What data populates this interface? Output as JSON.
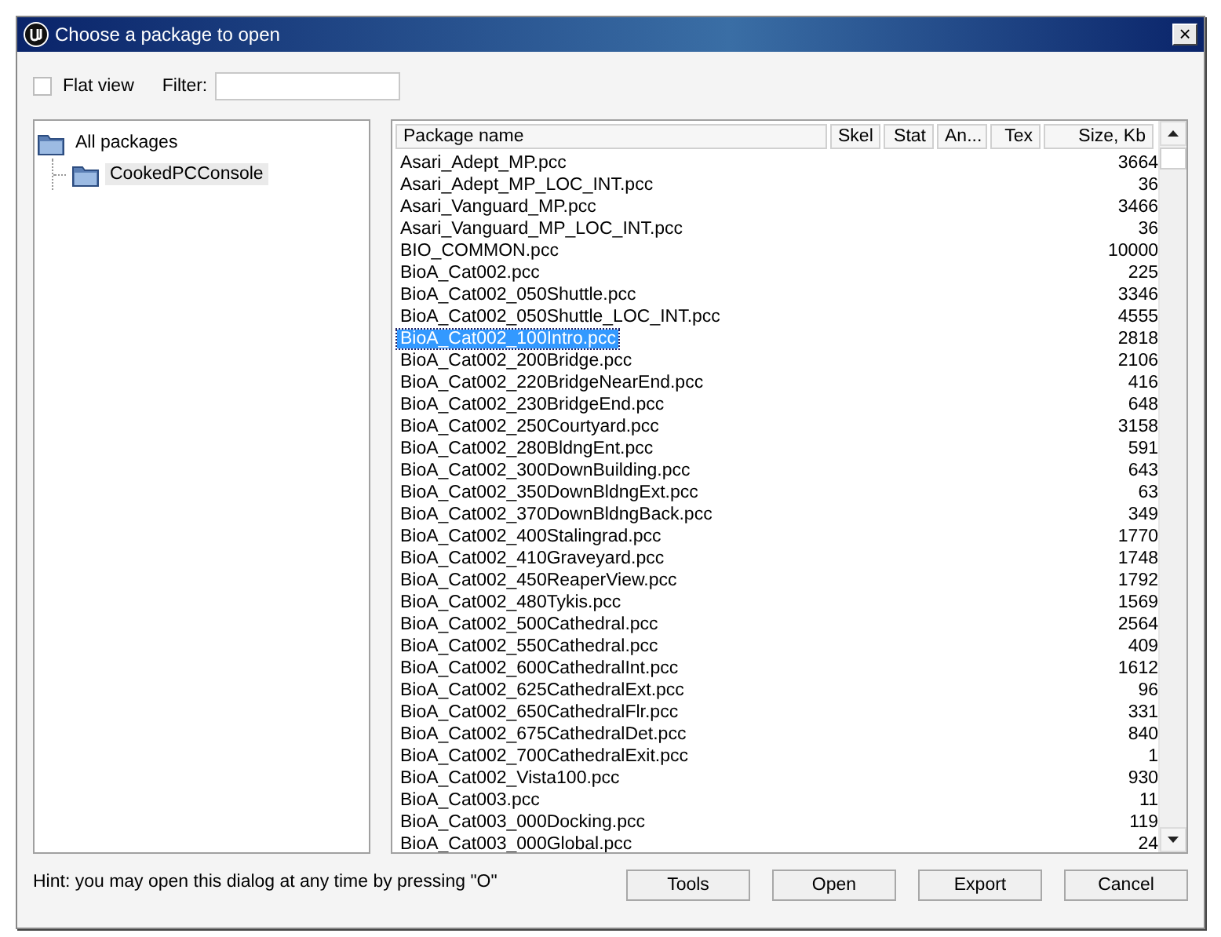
{
  "window": {
    "title": "Choose a package to open",
    "close": "×"
  },
  "toolbar": {
    "flat_view": {
      "label": "Flat view",
      "checked": false
    },
    "filter": {
      "label": "Filter:"
    }
  },
  "tree": [
    {
      "label": "All packages",
      "selected": false,
      "children": [
        {
          "label": "CookedPCConsole",
          "selected": true
        }
      ]
    }
  ],
  "table": {
    "columns": [
      "Package name",
      "Skel",
      "Stat",
      "An...",
      "Tex",
      "Size, Kb"
    ],
    "rows": [
      {
        "name": "Asari_Adept_MP.pcc",
        "size": "3664",
        "selected": false
      },
      {
        "name": "Asari_Adept_MP_LOC_INT.pcc",
        "size": "36",
        "selected": false
      },
      {
        "name": "Asari_Vanguard_MP.pcc",
        "size": "3466",
        "selected": false
      },
      {
        "name": "Asari_Vanguard_MP_LOC_INT.pcc",
        "size": "36",
        "selected": false
      },
      {
        "name": "BIO_COMMON.pcc",
        "size": "10000",
        "selected": false
      },
      {
        "name": "BioA_Cat002.pcc",
        "size": "225",
        "selected": false
      },
      {
        "name": "BioA_Cat002_050Shuttle.pcc",
        "size": "3346",
        "selected": false
      },
      {
        "name": "BioA_Cat002_050Shuttle_LOC_INT.pcc",
        "size": "4555",
        "selected": false
      },
      {
        "name": "BioA_Cat002_100Intro.pcc",
        "size": "2818",
        "selected": true
      },
      {
        "name": "BioA_Cat002_200Bridge.pcc",
        "size": "2106",
        "selected": false
      },
      {
        "name": "BioA_Cat002_220BridgeNearEnd.pcc",
        "size": "416",
        "selected": false
      },
      {
        "name": "BioA_Cat002_230BridgeEnd.pcc",
        "size": "648",
        "selected": false
      },
      {
        "name": "BioA_Cat002_250Courtyard.pcc",
        "size": "3158",
        "selected": false
      },
      {
        "name": "BioA_Cat002_280BldngEnt.pcc",
        "size": "591",
        "selected": false
      },
      {
        "name": "BioA_Cat002_300DownBuilding.pcc",
        "size": "643",
        "selected": false
      },
      {
        "name": "BioA_Cat002_350DownBldngExt.pcc",
        "size": "63",
        "selected": false
      },
      {
        "name": "BioA_Cat002_370DownBldngBack.pcc",
        "size": "349",
        "selected": false
      },
      {
        "name": "BioA_Cat002_400Stalingrad.pcc",
        "size": "1770",
        "selected": false
      },
      {
        "name": "BioA_Cat002_410Graveyard.pcc",
        "size": "1748",
        "selected": false
      },
      {
        "name": "BioA_Cat002_450ReaperView.pcc",
        "size": "1792",
        "selected": false
      },
      {
        "name": "BioA_Cat002_480Tykis.pcc",
        "size": "1569",
        "selected": false
      },
      {
        "name": "BioA_Cat002_500Cathedral.pcc",
        "size": "2564",
        "selected": false
      },
      {
        "name": "BioA_Cat002_550Cathedral.pcc",
        "size": "409",
        "selected": false
      },
      {
        "name": "BioA_Cat002_600CathedralInt.pcc",
        "size": "1612",
        "selected": false
      },
      {
        "name": "BioA_Cat002_625CathedralExt.pcc",
        "size": "96",
        "selected": false
      },
      {
        "name": "BioA_Cat002_650CathedralFlr.pcc",
        "size": "331",
        "selected": false
      },
      {
        "name": "BioA_Cat002_675CathedralDet.pcc",
        "size": "840",
        "selected": false
      },
      {
        "name": "BioA_Cat002_700CathedralExit.pcc",
        "size": "1",
        "selected": false
      },
      {
        "name": "BioA_Cat002_Vista100.pcc",
        "size": "930",
        "selected": false
      },
      {
        "name": "BioA_Cat003.pcc",
        "size": "11",
        "selected": false
      },
      {
        "name": "BioA_Cat003_000Docking.pcc",
        "size": "119",
        "selected": false
      },
      {
        "name": "BioA_Cat003_000Global.pcc",
        "size": "24",
        "selected": false
      }
    ]
  },
  "hint": "Hint: you may open this dialog at any time by pressing \"O\"",
  "buttons": [
    "Tools",
    "Open",
    "Export",
    "Cancel"
  ]
}
